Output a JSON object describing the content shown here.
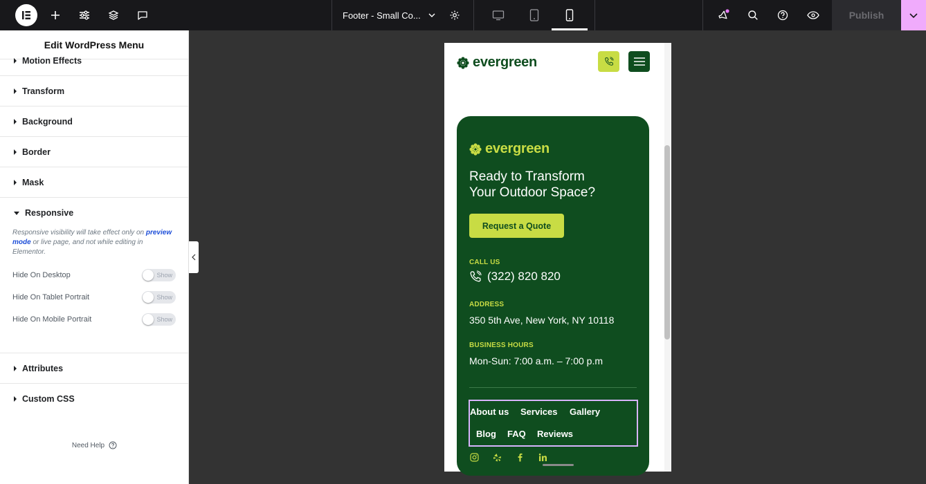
{
  "topbar": {
    "doc_title": "Footer - Small Co...",
    "publish_label": "Publish"
  },
  "panel": {
    "title": "Edit WordPress Menu",
    "sections_top": [
      "Motion Effects",
      "Transform",
      "Background",
      "Border",
      "Mask"
    ],
    "responsive": {
      "title": "Responsive",
      "note_part1": "Responsive visibility will take effect only on ",
      "note_link": "preview mode",
      "note_part2": " or live page, and not while editing in Elementor.",
      "rows": [
        {
          "label": "Hide On Desktop",
          "toggle": "Show"
        },
        {
          "label": "Hide On Tablet Portrait",
          "toggle": "Show"
        },
        {
          "label": "Hide On Mobile Portrait",
          "toggle": "Show"
        }
      ]
    },
    "sections_bottom": [
      "Attributes",
      "Custom CSS"
    ],
    "need_help": "Need Help"
  },
  "preview": {
    "brand": "evergreen",
    "card": {
      "brand": "evergreen",
      "headline_line1": "Ready to Transform",
      "headline_line2": "Your Outdoor Space?",
      "cta": "Request a Quote",
      "call_label": "CALL US",
      "phone": "(322) 820 820",
      "address_label": "ADDRESS",
      "address": "350 5th Ave, New York, NY 10118",
      "hours_label": "BUSINESS HOURS",
      "hours": "Mon-Sun: 7:00 a.m. – 7:00 p.m",
      "menu": [
        "About us",
        "Services",
        "Gallery",
        "Blog",
        "FAQ",
        "Reviews"
      ],
      "social": [
        "instagram-icon",
        "yelp-icon",
        "facebook-icon",
        "linkedin-icon"
      ]
    }
  },
  "colors": {
    "brand_green": "#0f4d1f",
    "brand_lime": "#c8dc44",
    "publish_accent": "#f0abfc"
  }
}
